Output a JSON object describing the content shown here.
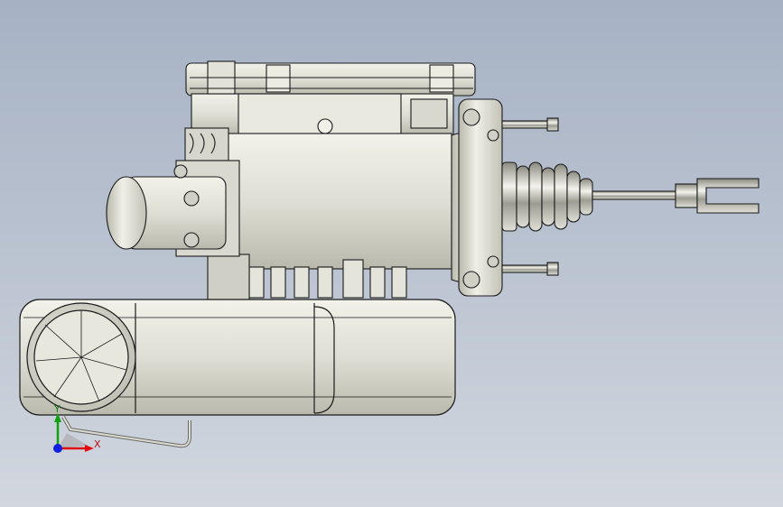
{
  "scene": {
    "description_ref": "cad-viewport",
    "triad": {
      "x_label": "X",
      "y_label": "Y"
    },
    "colors": {
      "background_top": "#a6b2c4",
      "background_bottom": "#d2d7df",
      "part_fill": "#e6e6dc",
      "part_shade": "#c9c9bd",
      "edge": "#1a1a1a",
      "axis_x": "#e01010",
      "axis_y": "#10a010",
      "axis_z": "#1020e0"
    }
  }
}
